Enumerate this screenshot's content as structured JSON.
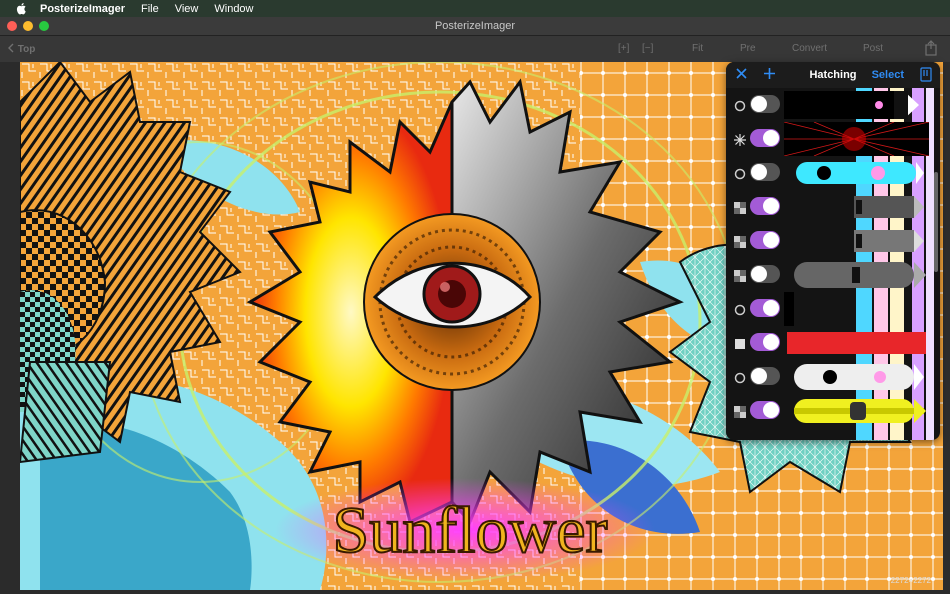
{
  "menubar": {
    "app_name": "PosterizeImager",
    "items": [
      "File",
      "View",
      "Window"
    ]
  },
  "window": {
    "title": "PosterizeImager"
  },
  "toolbar": {
    "back_label": "Top",
    "fit_label": "Fit",
    "pre_label": "Pre",
    "convert_label": "Convert",
    "post_label": "Post",
    "zoom_in_label": "[+]",
    "zoom_out_label": "[−]"
  },
  "canvas": {
    "poster_text": "Sunflower",
    "size_text": "2272×2272"
  },
  "panel": {
    "title": "Hatching",
    "select_label": "Select",
    "rows": [
      {
        "icon": "circle-outline-icon",
        "enabled": false
      },
      {
        "icon": "asterisk-icon",
        "enabled": true
      },
      {
        "icon": "circle-outline-icon",
        "enabled": false
      },
      {
        "icon": "checker-icon",
        "enabled": true
      },
      {
        "icon": "checker-icon",
        "enabled": true
      },
      {
        "icon": "checker-icon",
        "enabled": false
      },
      {
        "icon": "circle-outline-icon",
        "enabled": true
      },
      {
        "icon": "square-filled-icon",
        "enabled": true
      },
      {
        "icon": "circle-outline-icon",
        "enabled": false
      },
      {
        "icon": "checker-icon",
        "enabled": true
      }
    ]
  },
  "colors": {
    "accent_purple": "#a35bd6",
    "select_blue": "#2f8cf5",
    "poster_orange": "#f3a43a"
  }
}
